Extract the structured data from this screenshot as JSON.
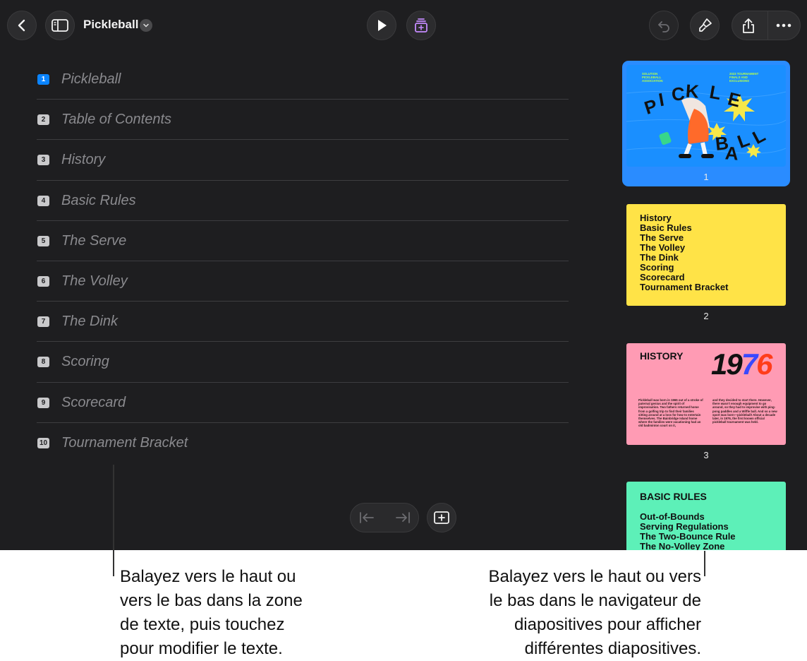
{
  "toolbar": {
    "title": "Pickleball"
  },
  "outline": {
    "rows": [
      {
        "num": "1",
        "text": "Pickleball"
      },
      {
        "num": "2",
        "text": "Table of Contents"
      },
      {
        "num": "3",
        "text": "History"
      },
      {
        "num": "4",
        "text": "Basic Rules"
      },
      {
        "num": "5",
        "text": "The Serve"
      },
      {
        "num": "6",
        "text": "The Volley"
      },
      {
        "num": "7",
        "text": "The Dink"
      },
      {
        "num": "8",
        "text": "Scoring"
      },
      {
        "num": "9",
        "text": "Scorecard"
      },
      {
        "num": "10",
        "text": "Tournament Bracket"
      }
    ]
  },
  "navigator": {
    "slide1": {
      "num": "1",
      "corner_left": "SOLUTION PICKLEBALL ASSOCIATION",
      "corner_right": "2023 TOURNAMENT FINALS AND EXCLUSIONS",
      "art_letters": [
        "P",
        "I",
        "C",
        "K",
        "L",
        "E",
        "B",
        "A",
        "L",
        "L"
      ]
    },
    "slide2": {
      "num": "2",
      "items": [
        "History",
        "Basic Rules",
        "The Serve",
        "The Volley",
        "The Dink",
        "Scoring",
        "Scorecard",
        "Tournament Bracket"
      ]
    },
    "slide3": {
      "num": "3",
      "heading": "HISTORY",
      "year_a": "19",
      "year_b": "7",
      "year_c": "6",
      "body_left": "Pickleball was born in 1965 out of a stroke of paternal genius and the spirit of improvisation. Two fathers returned home from a golfing trip to find their families sitting around at a loss for how to entertain themselves. The Bainbridge Island home where the families were vacationing had an old badminton court on it,",
      "body_right": "and they decided to start there. However, there wasn't enough equipment to go around, so they had to improvise with ping-pong paddles and a Wiffle ball. And so a new sport was born—pickleball! About a decade later, in 1976, the first known official pickleball tournament was held."
    },
    "slide4": {
      "heading": "BASIC RULES",
      "items": [
        "Out-of-Bounds",
        "Serving Regulations",
        "The Two-Bounce Rule",
        "The No-Volley Zone"
      ]
    }
  },
  "captions": {
    "left": [
      "Balayez vers le haut ou",
      "vers le bas dans la zone",
      "de texte, puis touchez",
      "pour modifier le texte."
    ],
    "right": [
      "Balayez vers le haut ou vers",
      "le bas dans le navigateur de",
      "diapositives pour afficher",
      "différentes diapositives."
    ]
  },
  "colors": {
    "app_bg": "#1e1e20",
    "accent_blue": "#0a84ff",
    "slide1_bg": "#1a8fff",
    "slide2_bg": "#ffe347",
    "slide3_bg": "#ff9bb4",
    "slide4_bg": "#5df0b8"
  }
}
